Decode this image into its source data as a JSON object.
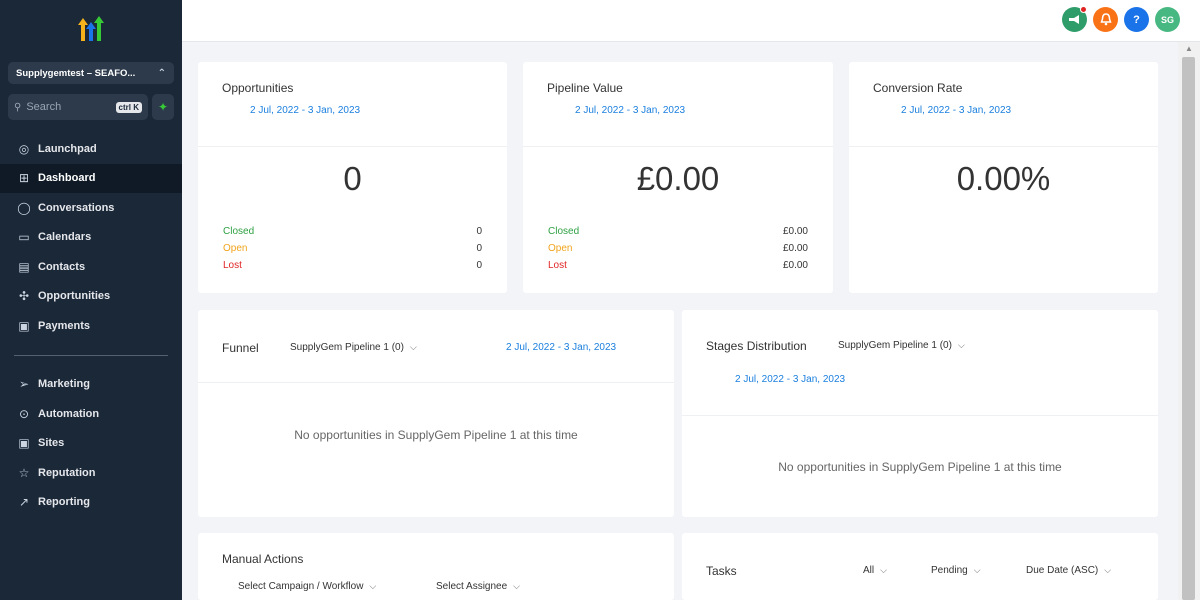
{
  "sidebar": {
    "account_name": "Supplygemtest – SEAFO...",
    "search_placeholder": "Search",
    "search_shortcut": "ctrl K",
    "nav_primary": [
      {
        "label": "Launchpad",
        "icon": "rocket-icon",
        "glyph": "◎"
      },
      {
        "label": "Dashboard",
        "icon": "dashboard-icon",
        "glyph": "⊞"
      },
      {
        "label": "Conversations",
        "icon": "chat-icon",
        "glyph": "◯"
      },
      {
        "label": "Calendars",
        "icon": "calendar-icon",
        "glyph": "▭"
      },
      {
        "label": "Contacts",
        "icon": "contacts-icon",
        "glyph": "▤"
      },
      {
        "label": "Opportunities",
        "icon": "opportunities-icon",
        "glyph": "✣"
      },
      {
        "label": "Payments",
        "icon": "payments-icon",
        "glyph": "▣"
      }
    ],
    "nav_secondary": [
      {
        "label": "Marketing",
        "icon": "send-icon",
        "glyph": "➢"
      },
      {
        "label": "Automation",
        "icon": "automation-icon",
        "glyph": "⊙"
      },
      {
        "label": "Sites",
        "icon": "sites-icon",
        "glyph": "▣"
      },
      {
        "label": "Reputation",
        "icon": "star-icon",
        "glyph": "☆"
      },
      {
        "label": "Reporting",
        "icon": "trend-icon",
        "glyph": "↗"
      }
    ],
    "active_item": "Dashboard"
  },
  "topbar": {
    "avatar_initials": "SG",
    "help_glyph": "?",
    "colors": {
      "megaphone": "#2f9d6a",
      "bell": "#f97316",
      "help": "#1a73e8",
      "avatar": "#47b881"
    }
  },
  "cards": {
    "opportunities": {
      "title": "Opportunities",
      "date_range": "2 Jul, 2022 - 3 Jan, 2023",
      "value": "0",
      "rows": [
        {
          "label": "Closed",
          "value": "0"
        },
        {
          "label": "Open",
          "value": "0"
        },
        {
          "label": "Lost",
          "value": "0"
        }
      ]
    },
    "pipeline_value": {
      "title": "Pipeline Value",
      "date_range": "2 Jul, 2022 - 3 Jan, 2023",
      "value": "£0.00",
      "rows": [
        {
          "label": "Closed",
          "value": "£0.00"
        },
        {
          "label": "Open",
          "value": "£0.00"
        },
        {
          "label": "Lost",
          "value": "£0.00"
        }
      ]
    },
    "conversion_rate": {
      "title": "Conversion Rate",
      "date_range": "2 Jul, 2022 - 3 Jan, 2023",
      "value": "0.00%"
    },
    "funnel": {
      "title": "Funnel",
      "pipeline": "SupplyGem Pipeline 1 (0)",
      "date_range": "2 Jul, 2022 - 3 Jan, 2023",
      "empty": "No opportunities in SupplyGem Pipeline 1 at this time"
    },
    "stages": {
      "title": "Stages Distribution",
      "pipeline": "SupplyGem Pipeline 1 (0)",
      "date_range": "2 Jul, 2022 - 3 Jan, 2023",
      "empty": "No opportunities in SupplyGem Pipeline 1 at this time"
    },
    "manual_actions": {
      "title": "Manual Actions",
      "campaign_select": "Select Campaign / Workflow",
      "assignee_select": "Select Assignee"
    },
    "tasks": {
      "title": "Tasks",
      "filter_all": "All",
      "filter_status": "Pending",
      "sort": "Due Date (ASC)"
    }
  }
}
